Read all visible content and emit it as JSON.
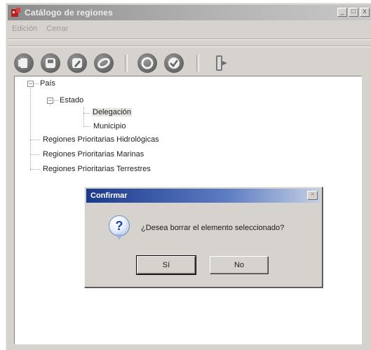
{
  "window": {
    "title": "Catálogo de regiones"
  },
  "menu": {
    "items": [
      "Edición",
      "Cerrar"
    ]
  },
  "titlebar_buttons": [
    "_",
    "□",
    "x"
  ],
  "toolbar": {
    "icons": [
      "first-record-icon",
      "save-icon",
      "edit-icon",
      "link-icon",
      "cancel-icon",
      "check-icon",
      "exit-icon"
    ]
  },
  "tree": {
    "pais": "País",
    "estado": "Estado",
    "delegacion": "Delegación",
    "municipio": "Municipio",
    "hidrologicas": "Regiones Prioritarias Hidrológicas",
    "marinas": "Regiones Prioritarias Marinas",
    "terrestres": "Regiones Prioritarias Terrestres"
  },
  "dialog": {
    "title": "Confirmar",
    "message": "¿Desea borrar el elemento seleccionado?",
    "icon": "question-icon",
    "yes_label": "Sí",
    "no_label": "No"
  }
}
